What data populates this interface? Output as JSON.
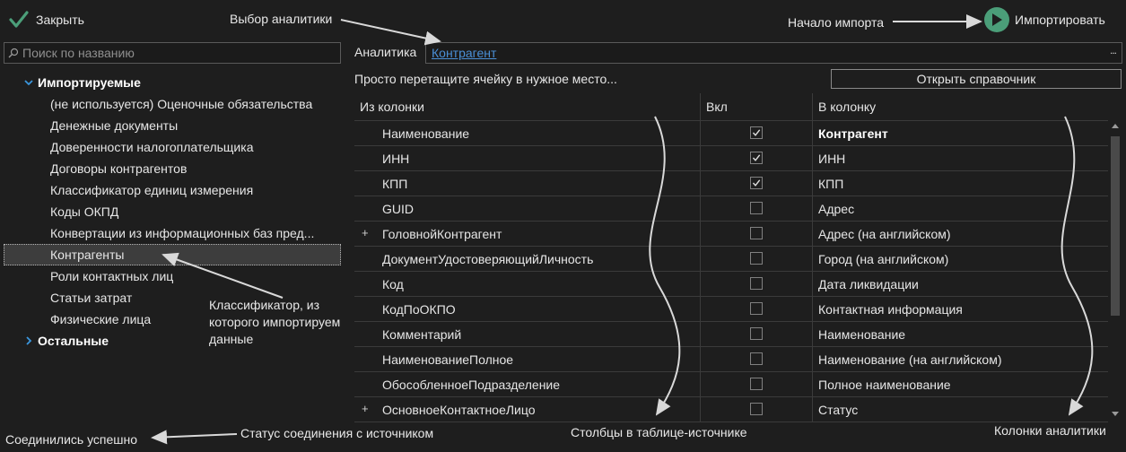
{
  "toolbar": {
    "close_label": "Закрыть",
    "import_label": "Импортировать"
  },
  "search": {
    "placeholder": "Поиск по названию"
  },
  "tree": {
    "group_imported": "Импортируемые",
    "items": [
      "(не используется) Оценочные обязательства",
      "Денежные документы",
      "Доверенности налогоплательщика",
      "Договоры контрагентов",
      "Классификатор единиц измерения",
      "Коды ОКПД",
      "Конвертации из информационных баз пред...",
      "Контрагенты",
      "Роли контактных лиц",
      "Статьи затрат",
      "Физические лица"
    ],
    "selected_index": 7,
    "group_other": "Остальные"
  },
  "analytics": {
    "label": "Аналитика",
    "value": "Контрагент",
    "more": "..."
  },
  "hint": "Просто перетащите ячейку в нужное место...",
  "open_reference_label": "Открыть справочник",
  "table": {
    "headers": {
      "source": "Из колонки",
      "include": "Вкл",
      "target": "В колонку"
    },
    "rows": [
      {
        "expand": "",
        "source": "Наименование",
        "checked": true,
        "target": "Контрагент"
      },
      {
        "expand": "",
        "source": "ИНН",
        "checked": true,
        "target": "ИНН"
      },
      {
        "expand": "",
        "source": "КПП",
        "checked": true,
        "target": "КПП"
      },
      {
        "expand": "",
        "source": "GUID",
        "checked": false,
        "target": "Адрес"
      },
      {
        "expand": "+",
        "source": "ГоловнойКонтрагент",
        "checked": false,
        "target": "Адрес (на английском)"
      },
      {
        "expand": "",
        "source": "ДокументУдостоверяющийЛичность",
        "checked": false,
        "target": "Город (на английском)"
      },
      {
        "expand": "",
        "source": "Код",
        "checked": false,
        "target": "Дата ликвидации"
      },
      {
        "expand": "",
        "source": "КодПоОКПО",
        "checked": false,
        "target": "Контактная информация"
      },
      {
        "expand": "",
        "source": "Комментарий",
        "checked": false,
        "target": "Наименование"
      },
      {
        "expand": "",
        "source": "НаименованиеПолное",
        "checked": false,
        "target": "Наименование (на английском)"
      },
      {
        "expand": "",
        "source": "ОбособленноеПодразделение",
        "checked": false,
        "target": "Полное наименование"
      },
      {
        "expand": "+",
        "source": "ОсновноеКонтактноеЛицо",
        "checked": false,
        "target": "Статус"
      }
    ]
  },
  "status": {
    "text": "Соединились успешно"
  },
  "annotations": {
    "analytics_choice": "Выбор аналитики",
    "import_start": "Начало импорта",
    "classifier_line1": "Классификатор, из",
    "classifier_line2": "которого импортируем",
    "classifier_line3": "данные",
    "connection_status": "Статус соединения с источником",
    "source_columns": "Столбцы в таблице-источнике",
    "analytics_columns": "Колонки аналитики"
  },
  "colors": {
    "background": "#1e1e1e",
    "accent_green": "#4b9e79",
    "link_blue": "#4a8fd6",
    "selection": "#3d3d3d"
  }
}
